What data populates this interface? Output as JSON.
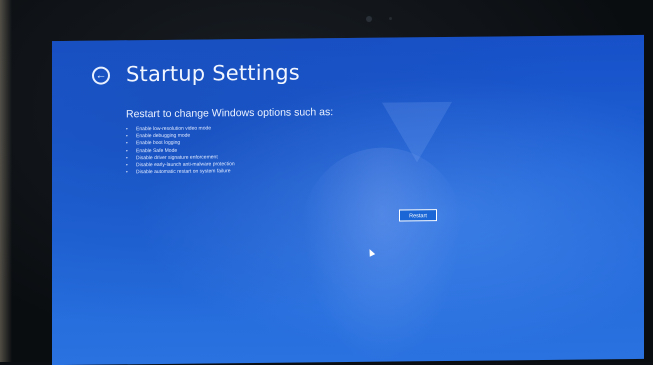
{
  "page": {
    "title": "Startup Settings",
    "subtitle": "Restart to change Windows options such as:",
    "options": [
      "Enable low-resolution video mode",
      "Enable debugging mode",
      "Enable boot logging",
      "Enable Safe Mode",
      "Disable driver signature enforcement",
      "Disable early-launch anti-malware protection",
      "Disable automatic restart on system failure"
    ],
    "restart_label": "Restart",
    "back_glyph": "←"
  },
  "icons": {
    "back": "back-arrow-icon",
    "cursor": "mouse-pointer-icon"
  },
  "colors": {
    "background": "#1e63d6",
    "text": "#f2f6ff",
    "button_border": "#ffffff"
  }
}
